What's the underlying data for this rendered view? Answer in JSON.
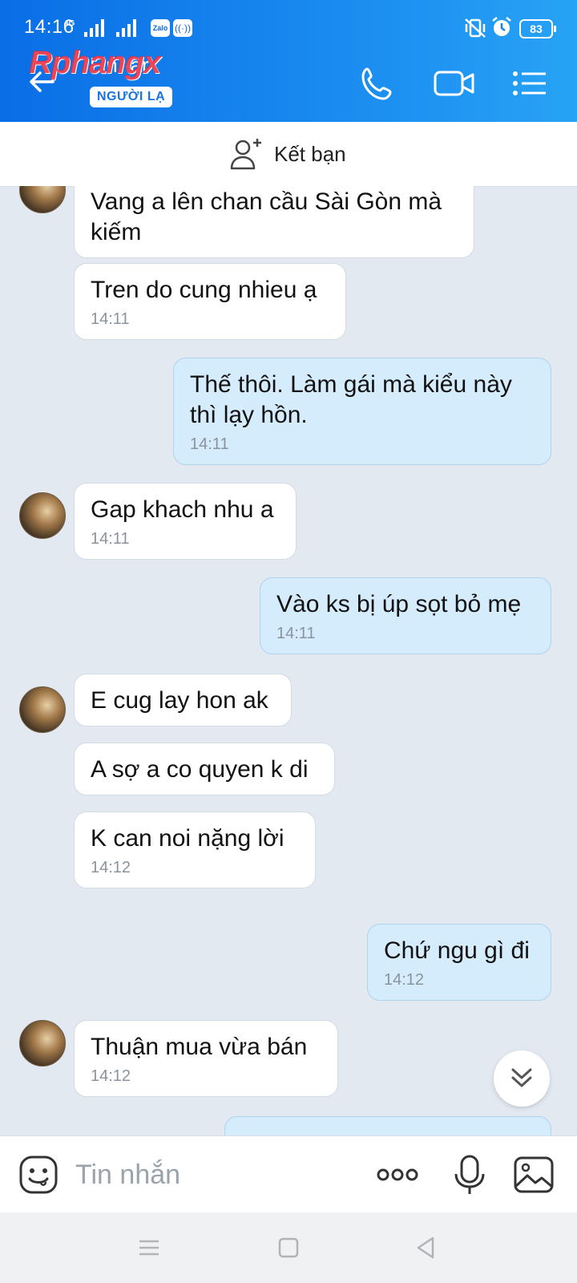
{
  "status_bar": {
    "time": "14:16",
    "network": "4G",
    "apps": [
      "zalo-icon",
      "hotspot-icon"
    ],
    "battery": "83",
    "zalo_label": "Zalo",
    "hotspot_label": "((·))"
  },
  "header": {
    "contact_name": "Lin ·ar",
    "watermark": "Rphangx",
    "stranger_badge": "NGƯỜI LẠ",
    "colors": {
      "gradient_start": "#0a6ee6",
      "gradient_end": "#27a3f5"
    }
  },
  "add_friend": {
    "label": "Kết bạn"
  },
  "messages": [
    {
      "direction": "in",
      "text": "Vang a lên chan cầu Sài Gòn mà kiếm",
      "time": ""
    },
    {
      "direction": "in",
      "text": "Tren do cung nhieu ạ",
      "time": "14:11"
    },
    {
      "direction": "out",
      "text": "Thế thôi. Làm gái mà kiểu này thì lạy hồn.",
      "time": "14:11"
    },
    {
      "direction": "in",
      "text": "Gap khach nhu a",
      "time": "14:11"
    },
    {
      "direction": "out",
      "text": "Vào ks bị úp sọt bỏ mẹ",
      "time": "14:11"
    },
    {
      "direction": "in",
      "text": "E cug lay hon ak",
      "time": ""
    },
    {
      "direction": "in",
      "text": "A sợ a co quyen k di",
      "time": ""
    },
    {
      "direction": "in",
      "text": "K can noi nặng lời",
      "time": "14:12"
    },
    {
      "direction": "out",
      "text": "Chứ ngu gì đi",
      "time": "14:12"
    },
    {
      "direction": "in",
      "text": "Thuận mua vừa bán",
      "time": "14:12"
    }
  ],
  "input_bar": {
    "placeholder": "Tin nhắn"
  },
  "colors": {
    "bubble_out": "#d5ecfd",
    "bubble_in": "#ffffff",
    "chat_bg": "#e2e9f1"
  }
}
